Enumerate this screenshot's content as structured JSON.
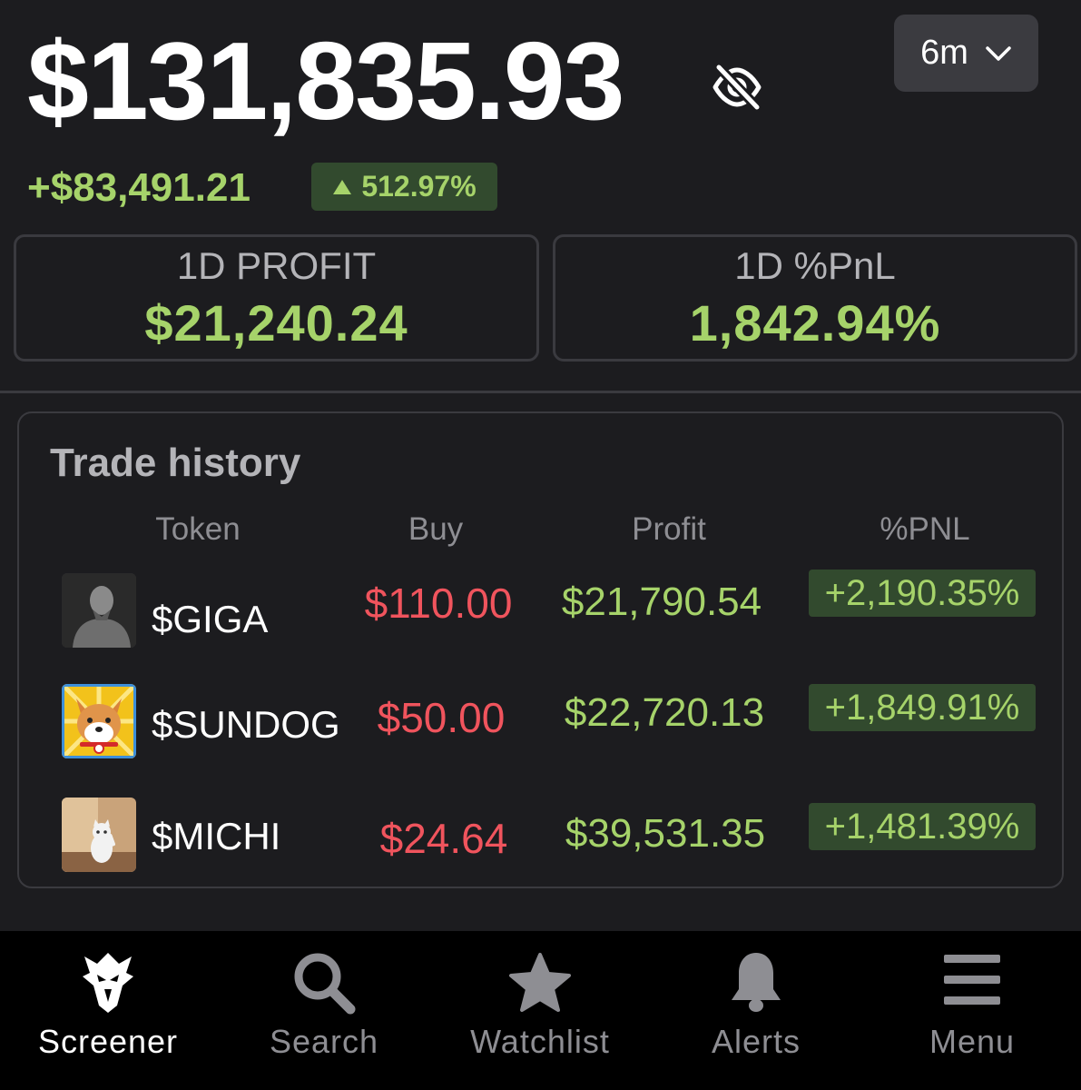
{
  "header": {
    "balance": "$131,835.93",
    "range_label": "6m",
    "pnl_abs": "+$83,491.21",
    "pnl_pct": "512.97%"
  },
  "stats": [
    {
      "label": "1D PROFIT",
      "value": "$21,240.24"
    },
    {
      "label": "1D %PnL",
      "value": "1,842.94%"
    }
  ],
  "trade_history": {
    "title": "Trade history",
    "columns": [
      "Token",
      "Buy",
      "Profit",
      "%PNL"
    ],
    "rows": [
      {
        "token": "$GIGA",
        "buy": "$110.00",
        "profit": "$21,790.54",
        "pnl": "+2,190.35%"
      },
      {
        "token": "$SUNDOG",
        "buy": "$50.00",
        "profit": "$22,720.13",
        "pnl": "+1,849.91%"
      },
      {
        "token": "$MICHI",
        "buy": "$24.64",
        "profit": "$39,531.35",
        "pnl": "+1,481.39%"
      }
    ]
  },
  "nav": {
    "items": [
      {
        "label": "Screener",
        "icon": "eagle-icon"
      },
      {
        "label": "Search",
        "icon": "search-icon"
      },
      {
        "label": "Watchlist",
        "icon": "star-icon"
      },
      {
        "label": "Alerts",
        "icon": "bell-icon"
      },
      {
        "label": "Menu",
        "icon": "hamburger-menu-icon"
      }
    ],
    "active": "Screener"
  },
  "colors": {
    "background": "#1c1c1f",
    "positive": "#a6d36a",
    "negative": "#f0545d",
    "positive_badge_bg": "#324a2e"
  }
}
